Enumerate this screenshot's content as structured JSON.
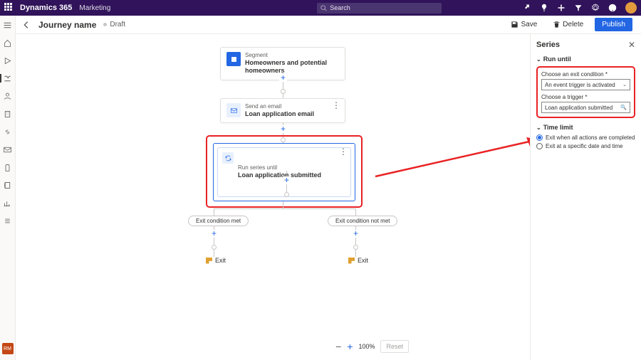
{
  "topbar": {
    "app": "Dynamics 365",
    "module": "Marketing",
    "search_placeholder": "Search"
  },
  "cmdbar": {
    "title": "Journey name",
    "status": "Draft",
    "save": "Save",
    "delete": "Delete",
    "publish": "Publish"
  },
  "nav_badge": "RM",
  "canvas": {
    "segment": {
      "sub": "Segment",
      "title": "Homeowners and potential homeowners"
    },
    "email": {
      "sub": "Send an email",
      "title": "Loan application email"
    },
    "series": {
      "sub": "Run series until",
      "title": "Loan application submitted"
    },
    "pill_met": "Exit condition met",
    "pill_not": "Exit condition not met",
    "exit": "Exit",
    "zoom_pct": "100%",
    "reset": "Reset"
  },
  "panel": {
    "heading": "Series",
    "run_until": "Run until",
    "exit_lbl": "Choose an exit condition *",
    "exit_val": "An event trigger is activated",
    "trigger_lbl": "Choose a trigger *",
    "trigger_val": "Loan application submitted",
    "time_limit": "Time limit",
    "radio1": "Exit when all actions are completed",
    "radio2": "Exit at a specific date and time"
  }
}
